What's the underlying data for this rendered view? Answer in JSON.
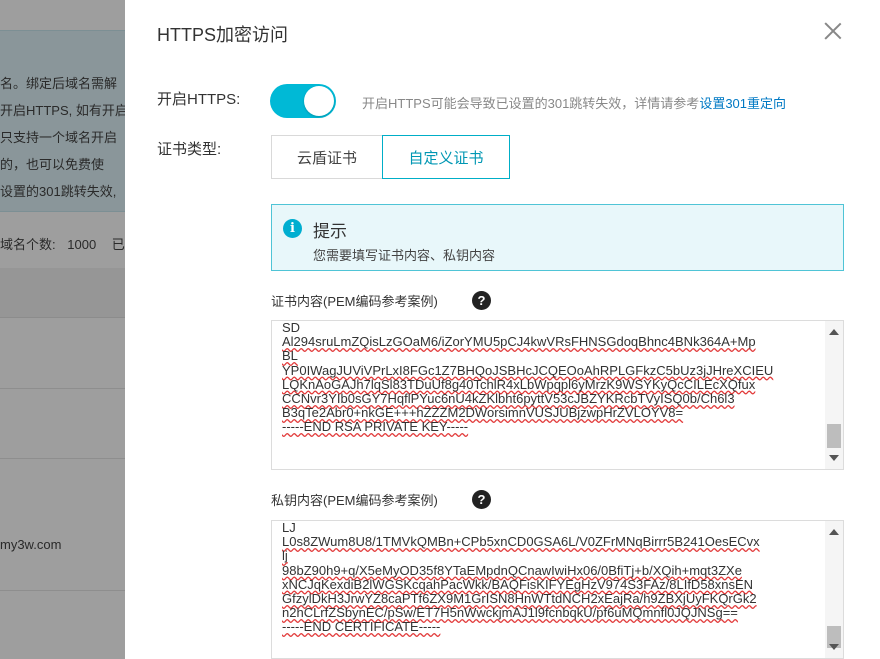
{
  "background": {
    "banner_lines": [
      "名。绑定后域名需解",
      "开启HTTPS, 如有开启",
      "只支持一个域名开启",
      "的，也可以免费使",
      "设置的301跳转失效,"
    ],
    "stat_label": "域名个数:",
    "stat_value": "1000",
    "stat_extra": "已",
    "domain_text": "my3w.com"
  },
  "dialog": {
    "title": "HTTPS加密访问",
    "https_label": "开启HTTPS:",
    "https_enabled": true,
    "https_hint": "开启HTTPS可能会导致已设置的301跳转失效，详情请参考",
    "https_hint_link": "设置301重定向",
    "cert_type_label": "证书类型:",
    "cert_tabs": [
      {
        "label": "云盾证书",
        "selected": false
      },
      {
        "label": "自定义证书",
        "selected": true
      }
    ],
    "notice": {
      "title": "提示",
      "body": "您需要填写证书内容、私钥内容"
    },
    "cert_content": {
      "label": "证书内容(PEM编码参考案例)",
      "lines": [
        "SD",
        "Al294sruLmZQisLzGOaM6/iZorYMU5pCJ4kwVRsFHNSGdoqBhnc4BNk364A+Mp",
        "BL",
        "YP0IWagJUViVPrLxI8FGc1Z7BHQoJSBHcJCQEOoAhRPLGFkzC5bUz3jJHreXCIEU",
        "LQKnAoGAJh7lqSl83TDuUf8g40TchlR4xLbWpqpl6yMrzK9WSYKyQcCILEcXQfux",
        "CCNvr3YIb0sGY7HqflPYuc6nU4kZKlbht6pyttV53cJBZYKRcbTVyISQ0b/Ch6l3",
        "B3qTe2Abr0+nkGE+++hZZZM2DWorsimnVUSJUBjzwpHrZVLOYV8=",
        "-----END RSA PRIVATE KEY-----"
      ]
    },
    "private_key": {
      "label": "私钥内容(PEM编码参考案例)",
      "lines": [
        "LJ",
        "L0s8ZWum8U8/1TMVkQMBn+CPb5xnCD0GSA6L/V0ZFrMNqBirrr5B241OesECvx",
        "lj",
        "98bZ90h9+q/X5eMyOD35f8YTaEMpdnQCnawIwiHx06/0BfiTj+b/XQih+mqt3ZXe",
        "xNCJqKexdiB2lWGSKcqahPacWkk/BAQFisKIFYEgHzV974S3FAz/8LIfD58xnsEN",
        "GfzylDkH3JrwYZ8caPTf6ZX9M1GrISN8HnWTtdNCH2xEajRa/h9ZBXjUyFKQrGk2",
        "n2hCLrfZSbynEC/pSw/ET7H5nWwckjmAJ1l9fcnbqkU/pf6uMQmnfl0JQJNSg==",
        "-----END CERTIFICATE-----"
      ]
    }
  },
  "colors": {
    "accent": "#00b9d6",
    "link": "#0079c4",
    "notice_bg": "#e8f7fa",
    "notice_border": "#4fc4d6"
  }
}
